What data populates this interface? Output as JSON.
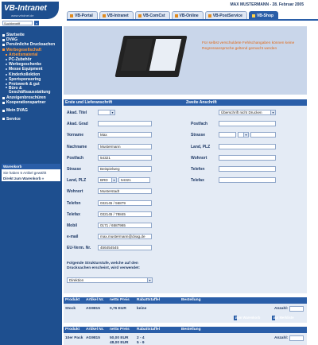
{
  "header": {
    "logo_text": "VB-Intranet",
    "logo_sub": "www.vrbdnet.de",
    "user_line": "MAX MUSTERMANN - 28. Februar 2005",
    "tabs": [
      "VB-Portal",
      "VB-Intranet",
      "VB-ComCst",
      "VB-Online",
      "VB-PostService",
      "VB-Shop"
    ],
    "active_tab": "VB-Shop",
    "search_value": "Suchbegriff",
    "search_button": "»"
  },
  "sidebar": {
    "items": [
      {
        "label": "Startseite",
        "level": 0
      },
      {
        "label": "DVAG",
        "level": 0
      },
      {
        "label": "Persönliche Drucksachen",
        "level": 0
      },
      {
        "label": "Werbegesellschaft",
        "level": 0,
        "highlight": true
      },
      {
        "label": "Arbeitsmaterial",
        "level": 1,
        "highlight": true
      },
      {
        "label": "PC-Zubehör",
        "level": 1
      },
      {
        "label": "Werbegeschenke",
        "level": 1
      },
      {
        "label": "Messe Equipment",
        "level": 1
      },
      {
        "label": "Kinderkollektion",
        "level": 1
      },
      {
        "label": "Sportsponsoring",
        "level": 1
      },
      {
        "label": "Protowerk & gut",
        "level": 1
      },
      {
        "label": "Büro & Geschäftsausstattung",
        "level": 1,
        "wrap": true
      },
      {
        "label": "Anzeigenbroschüren",
        "level": 0
      },
      {
        "label": "Kooperationspartner",
        "level": 0
      },
      {
        "label": "Mein DVAG",
        "level": 0,
        "gap_before": true
      },
      {
        "label": "Service",
        "level": 0,
        "gap_before": true
      }
    ],
    "cart": {
      "title": "Warenkorb",
      "text": "Sie haben 5 Artikel gewählt",
      "link": "Direkt zum Warenkorb »"
    }
  },
  "hero": {
    "text": "Für selbst verschuldete Fehlschangaben können keine Regressansprüche geltend gemacht werden"
  },
  "form": {
    "left_title": "Erste und Lieferanschrift",
    "right_title": "Zweite Anschrift",
    "left": [
      {
        "label": "Akad. Titel",
        "value": "",
        "type": "select"
      },
      {
        "label": "Akad. Grad",
        "value": "",
        "type": "text"
      },
      {
        "label": "Vorname",
        "value": "Max",
        "type": "text"
      },
      {
        "label": "Nachname",
        "value": "Mustermann",
        "type": "text"
      },
      {
        "label": "Postfach",
        "value": "54321",
        "type": "text"
      },
      {
        "label": "Strasse",
        "value": "Beispielweg",
        "type": "text"
      },
      {
        "label": "Land, PLZ",
        "value": "BRD",
        "value2": "54321",
        "type": "select-plz"
      },
      {
        "label": "Wohnort",
        "value": "Musterstadt",
        "type": "text"
      },
      {
        "label": "Telefon",
        "value": "032145 / 56879",
        "type": "text"
      },
      {
        "label": "Telefax",
        "value": "032145 / 78845",
        "type": "text"
      },
      {
        "label": "Mobil",
        "value": "0171 / 6587965",
        "type": "text"
      },
      {
        "label": "e-mail",
        "value": "max.mustermann@dvag.de",
        "type": "text"
      },
      {
        "label": "EU-Verm. Nr.",
        "value": "456454545",
        "type": "text"
      }
    ],
    "right_select": "Überschrift nicht Drucken",
    "right": [
      {
        "label": "Postfach",
        "value": ""
      },
      {
        "label": "Strasse",
        "value": ""
      },
      {
        "label": "Land, PLZ",
        "value": ""
      },
      {
        "label": "Wohnort",
        "value": ""
      },
      {
        "label": "Telefon",
        "value": ""
      },
      {
        "label": "Telefax",
        "value": ""
      }
    ],
    "note": "Folgende Strukturstufe, welche auf den Drucksachen erscheint, wird verwendet:",
    "level_select": "Direktion"
  },
  "products": [
    {
      "headers": [
        "Produkt",
        "Artikel Nr.",
        "netto Preis",
        "Rabattstaffel",
        "Bestellung"
      ],
      "rows": [
        {
          "produkt": "Stock",
          "artikel": "AG9815",
          "preis": [
            "0,76 EUR"
          ],
          "staffel": [
            "keine"
          ]
        }
      ],
      "qty_label": "Anzahl:",
      "buttons": [
        "zum Warenkorb",
        "zur Merkliste"
      ]
    },
    {
      "headers": [
        "Produkt",
        "Artikel Nr.",
        "netto Preis",
        "Rabattstaffel",
        "Bestellung"
      ],
      "rows": [
        {
          "produkt": "10er Pack",
          "artikel": "AG9815",
          "preis": [
            "50,00 EUR",
            "48,00 EUR",
            "43,00 EUR"
          ],
          "staffel": [
            "2 - 4",
            "5 - 9",
            "10+"
          ]
        }
      ],
      "qty_label": "Anzahl:",
      "buttons": [
        "zum Warenkorb",
        "zur Merkliste"
      ]
    }
  ]
}
